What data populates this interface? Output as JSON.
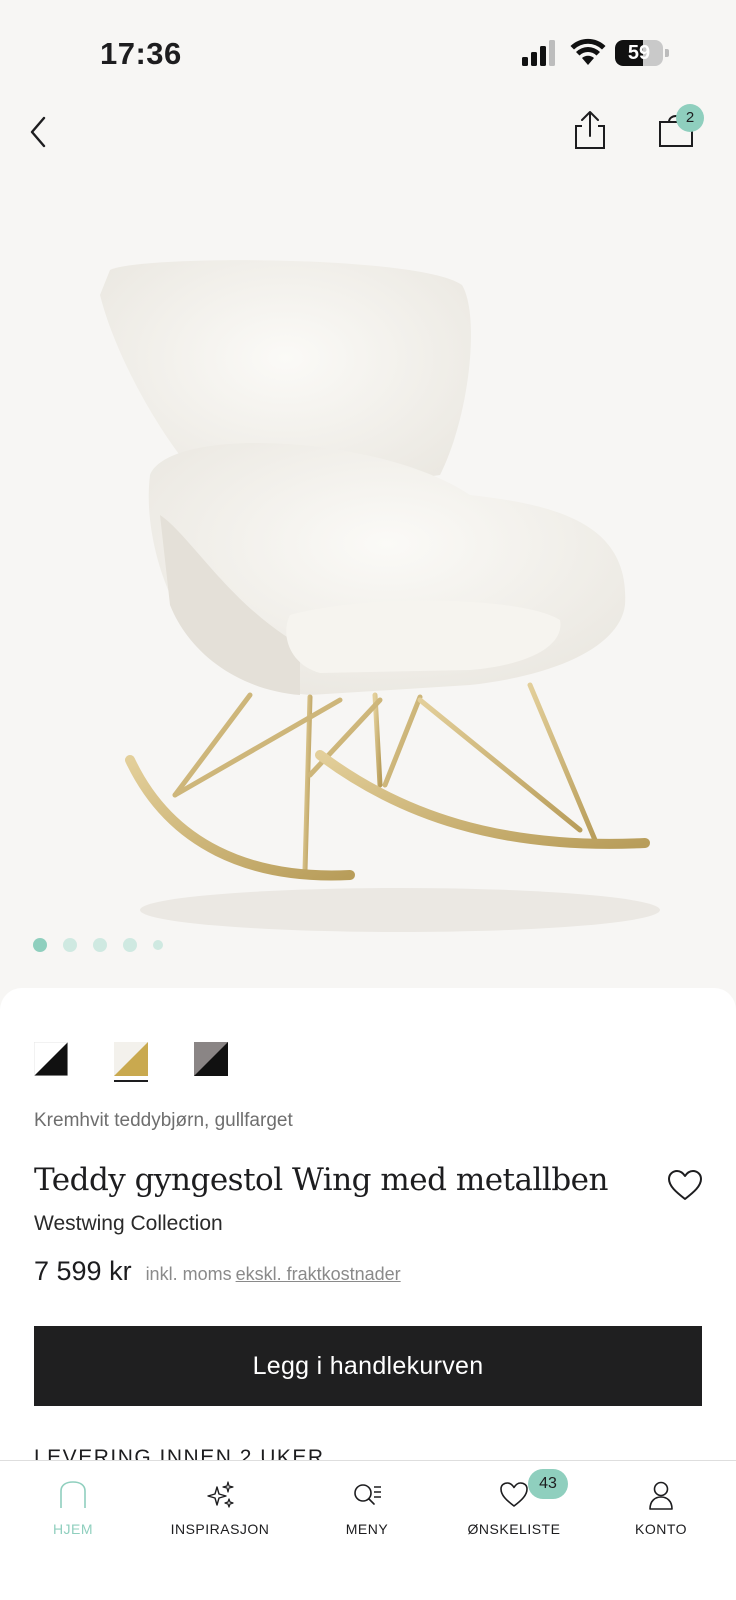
{
  "status_bar": {
    "time": "17:36",
    "battery": "59",
    "battery_level": 0.59
  },
  "nav": {
    "cart_count": "2"
  },
  "gallery": {
    "image_count": 5,
    "active_index": 0
  },
  "colors": {
    "accent": "#8fcfbe",
    "dark": "#1f1f20"
  },
  "product": {
    "variant": "Kremhvit teddybjørn, gullfarget",
    "title": "Teddy gyngestol Wing med metallben",
    "brand": "Westwing Collection",
    "price": "7 599 kr",
    "vat_note": "inkl. moms",
    "shipping_note": "ekskl. fraktkostnader",
    "swatches": [
      "black-white",
      "gold-white",
      "grey-black"
    ],
    "selected_swatch": 1
  },
  "cta": {
    "label": "Legg i handlekurven"
  },
  "delivery": {
    "heading": "LEVERING INNEN 2 UKER"
  },
  "tabbar": {
    "items": [
      {
        "label": "HJEM",
        "icon": "home-icon",
        "active": true
      },
      {
        "label": "INSPIRASJON",
        "icon": "sparkle-icon"
      },
      {
        "label": "MENY",
        "icon": "search-menu-icon"
      },
      {
        "label": "ØNSKELISTE",
        "icon": "heart-icon",
        "badge": "43"
      },
      {
        "label": "KONTO",
        "icon": "user-icon"
      }
    ]
  }
}
